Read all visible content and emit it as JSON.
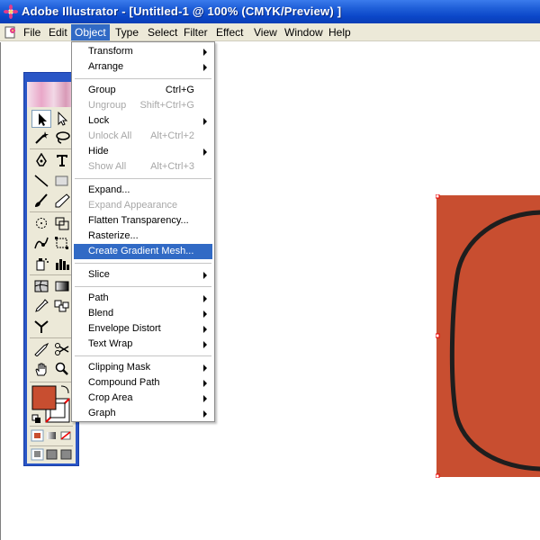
{
  "window": {
    "title": "Adobe Illustrator - [Untitled-1 @ 100% (CMYK/Preview) ]"
  },
  "menubar": {
    "items": [
      "File",
      "Edit",
      "Object",
      "Type",
      "Select",
      "Filter",
      "Effect",
      "View",
      "Window",
      "Help"
    ],
    "active": "Object"
  },
  "object_menu": {
    "items": [
      {
        "label": "Transform",
        "submenu": true
      },
      {
        "label": "Arrange",
        "submenu": true
      },
      {
        "label": "Group",
        "shortcut": "Ctrl+G"
      },
      {
        "label": "Ungroup",
        "shortcut": "Shift+Ctrl+G",
        "disabled": true
      },
      {
        "label": "Lock",
        "submenu": true
      },
      {
        "label": "Unlock All",
        "shortcut": "Alt+Ctrl+2",
        "disabled": true
      },
      {
        "label": "Hide",
        "submenu": true
      },
      {
        "label": "Show All",
        "shortcut": "Alt+Ctrl+3",
        "disabled": true
      },
      {
        "label": "Expand..."
      },
      {
        "label": "Expand Appearance",
        "disabled": true
      },
      {
        "label": "Flatten Transparency..."
      },
      {
        "label": "Rasterize..."
      },
      {
        "label": "Create Gradient Mesh...",
        "highlighted": true
      },
      {
        "label": "Slice",
        "submenu": true
      },
      {
        "label": "Path",
        "submenu": true
      },
      {
        "label": "Blend",
        "submenu": true
      },
      {
        "label": "Envelope Distort",
        "submenu": true
      },
      {
        "label": "Text Wrap",
        "submenu": true
      },
      {
        "label": "Clipping Mask",
        "submenu": true
      },
      {
        "label": "Compound Path",
        "submenu": true
      },
      {
        "label": "Crop Area",
        "submenu": true
      },
      {
        "label": "Graph",
        "submenu": true
      }
    ]
  },
  "toolbox": {
    "fill_color": "#c84e30",
    "stroke": "none"
  },
  "artwork": {
    "fill_color": "#c84e30",
    "stroke_color": "#1e1e1e"
  },
  "colors": {
    "titlebar": "#0b47c9",
    "menu_highlight": "#316ac5",
    "menubar_bg": "#ece9d8"
  }
}
